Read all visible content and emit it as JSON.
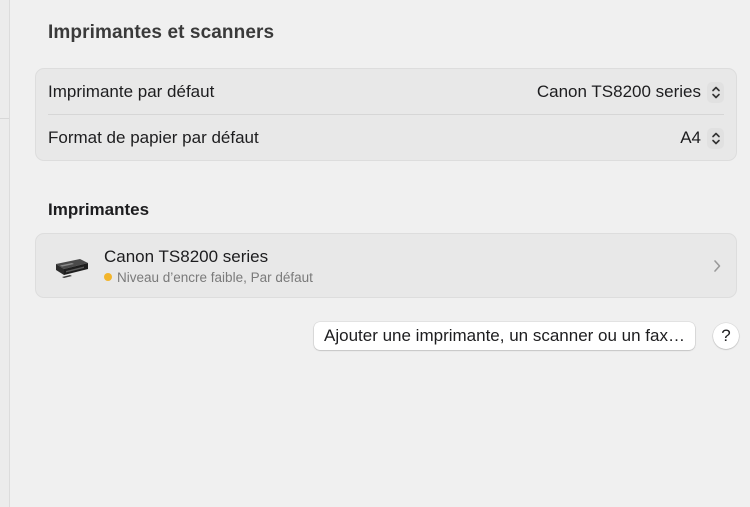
{
  "pane": {
    "title": "Imprimantes et scanners"
  },
  "settings": {
    "default_printer": {
      "label": "Imprimante par défaut",
      "value": "Canon TS8200 series",
      "icon": "up-down-chevron-icon"
    },
    "default_paper": {
      "label": "Format de papier par défaut",
      "value": "A4",
      "icon": "up-down-chevron-icon"
    }
  },
  "printers": {
    "section_title": "Imprimantes",
    "items": [
      {
        "name": "Canon TS8200 series",
        "status": "Niveau d’encre faible, Par défaut",
        "status_color": "#f2b52c",
        "icon": "printer-icon"
      }
    ]
  },
  "actions": {
    "add_label": "Ajouter une imprimante, un scanner ou un fax…",
    "help_label": "?"
  }
}
